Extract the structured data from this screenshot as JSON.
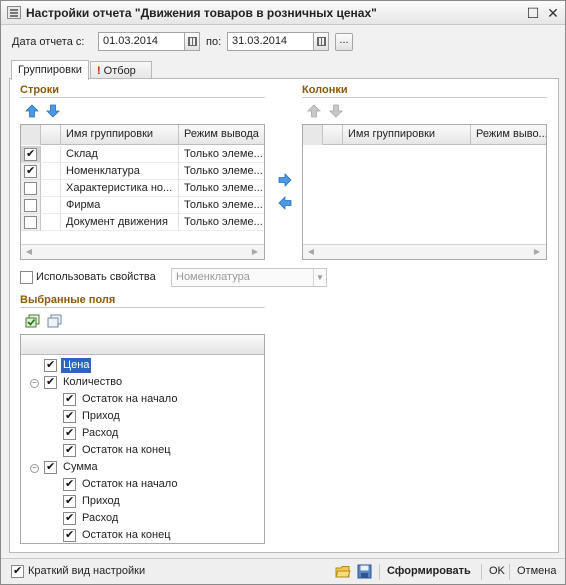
{
  "window": {
    "title": "Настройки отчета \"Движения товаров в розничных ценах\""
  },
  "period": {
    "from_label": "Дата отчета с:",
    "from_value": "01.03.2014",
    "to_label": "по:",
    "to_value": "31.03.2014",
    "more_label": "..."
  },
  "tabs": [
    {
      "label": "Группировки",
      "active": true
    },
    {
      "label": "Отбор",
      "active": false,
      "marker": "!"
    }
  ],
  "rows_section": {
    "title": "Строки",
    "columns": [
      "Имя группировки",
      "Режим вывода"
    ],
    "items": [
      {
        "checked": true,
        "name": "Склад",
        "mode": "Только элеме...",
        "selected": true
      },
      {
        "checked": true,
        "name": "Номенклатура",
        "mode": "Только элеме..."
      },
      {
        "checked": false,
        "name": "Характеристика но...",
        "mode": "Только элеме..."
      },
      {
        "checked": false,
        "name": "Фирма",
        "mode": "Только элеме..."
      },
      {
        "checked": false,
        "name": "Документ движения",
        "mode": "Только элеме..."
      }
    ]
  },
  "columns_section": {
    "title": "Колонки",
    "columns": [
      "Имя группировки",
      "Режим выво..."
    ]
  },
  "use_properties": {
    "label": "Использовать свойства",
    "checked": false,
    "combo_value": "Номенклатура"
  },
  "selected_fields": {
    "title": "Выбранные поля",
    "tree": [
      {
        "label": "Цена",
        "level": 1,
        "checked": true,
        "highlighted": true
      },
      {
        "label": "Количество",
        "level": 1,
        "checked": true,
        "expander": "minus"
      },
      {
        "label": "Остаток на начало",
        "level": 2,
        "checked": true
      },
      {
        "label": "Приход",
        "level": 2,
        "checked": true
      },
      {
        "label": "Расход",
        "level": 2,
        "checked": true
      },
      {
        "label": "Остаток на конец",
        "level": 2,
        "checked": true
      },
      {
        "label": "Сумма",
        "level": 1,
        "checked": true,
        "expander": "minus"
      },
      {
        "label": "Остаток на начало",
        "level": 2,
        "checked": true
      },
      {
        "label": "Приход",
        "level": 2,
        "checked": true
      },
      {
        "label": "Расход",
        "level": 2,
        "checked": true
      },
      {
        "label": "Остаток на конец",
        "level": 2,
        "checked": true
      }
    ]
  },
  "footer": {
    "short_view_label": "Краткий вид настройки",
    "short_view_checked": true,
    "generate_label": "Сформировать",
    "ok_label": "OK",
    "cancel_label": "Отмена"
  },
  "icons": {
    "up": "arrow-up-icon",
    "down": "arrow-down-icon",
    "move_right": "arrow-right-icon",
    "move_left": "arrow-left-icon",
    "check_all": "check-all-icon",
    "uncheck_all": "uncheck-all-icon",
    "calendar": "calendar-icon",
    "open": "folder-open-icon",
    "save": "save-icon"
  },
  "colors": {
    "section_title": "#8b5a0f",
    "highlight": "#2f64c4",
    "arrow": "#3d8ee0"
  }
}
